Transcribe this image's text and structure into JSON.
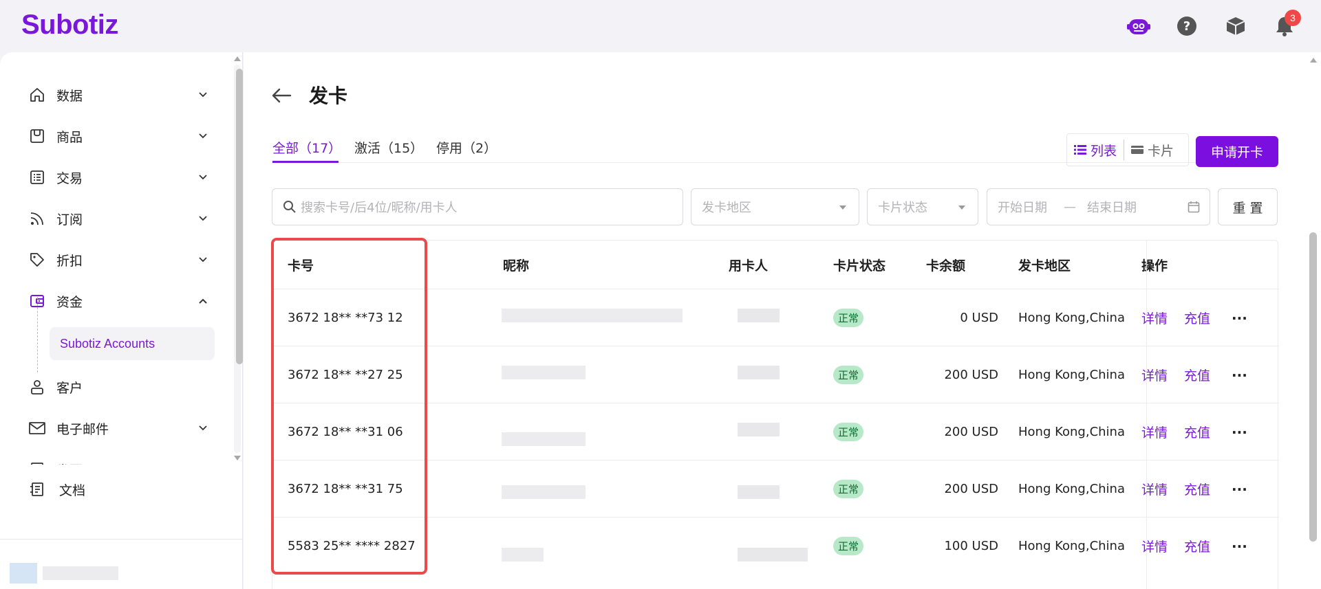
{
  "app": {
    "logo": "Subotiz",
    "notification_count": "3"
  },
  "topbar": {
    "icons": [
      "assistant-icon",
      "help-icon",
      "box-icon",
      "bell-icon"
    ]
  },
  "sidebar": {
    "items": [
      {
        "label": "数据",
        "icon": "home-icon"
      },
      {
        "label": "商品",
        "icon": "shop-icon"
      },
      {
        "label": "交易",
        "icon": "list-icon"
      },
      {
        "label": "订阅",
        "icon": "rss-icon"
      },
      {
        "label": "折扣",
        "icon": "tag-icon"
      },
      {
        "label": "资金",
        "icon": "wallet-icon"
      },
      {
        "label": "客户",
        "icon": "person-icon"
      },
      {
        "label": "电子邮件",
        "icon": "mail-icon"
      },
      {
        "label": "发票",
        "icon": "invoice-icon"
      }
    ],
    "sub_item": "Subotiz Accounts",
    "docs": "文档"
  },
  "page": {
    "title": "发卡",
    "tabs": [
      {
        "label": "全部（17）"
      },
      {
        "label": "激活（15）"
      },
      {
        "label": "停用（2）"
      }
    ],
    "view_list": "列表",
    "view_card": "卡片",
    "apply_button": "申请开卡"
  },
  "filters": {
    "search_placeholder": "搜索卡号/后4位/昵称/用卡人",
    "region_placeholder": "发卡地区",
    "status_placeholder": "卡片状态",
    "start_date": "开始日期",
    "date_sep": "—",
    "end_date": "结束日期",
    "reset": "重 置"
  },
  "table": {
    "columns": [
      "卡号",
      "昵称",
      "用卡人",
      "卡片状态",
      "卡余额",
      "发卡地区",
      "操作"
    ],
    "rows": [
      {
        "card": "3672 18** **73 12",
        "status": "正常",
        "balance": "0 USD",
        "region": "Hong Kong,China"
      },
      {
        "card": "3672 18** **27 25",
        "status": "正常",
        "balance": "200 USD",
        "region": "Hong Kong,China"
      },
      {
        "card": "3672 18** **31 06",
        "status": "正常",
        "balance": "200 USD",
        "region": "Hong Kong,China"
      },
      {
        "card": "3672 18** **31 75",
        "status": "正常",
        "balance": "200 USD",
        "region": "Hong Kong,China"
      },
      {
        "card": "5583 25** **** 2827",
        "status": "正常",
        "balance": "100 USD",
        "region": "Hong Kong,China"
      }
    ],
    "action_detail": "详情",
    "action_recharge": "充值",
    "action_more": "···"
  },
  "colors": {
    "accent": "#7a18d9",
    "status_bg": "#b7e9c9",
    "highlight": "#ea4a4a"
  }
}
